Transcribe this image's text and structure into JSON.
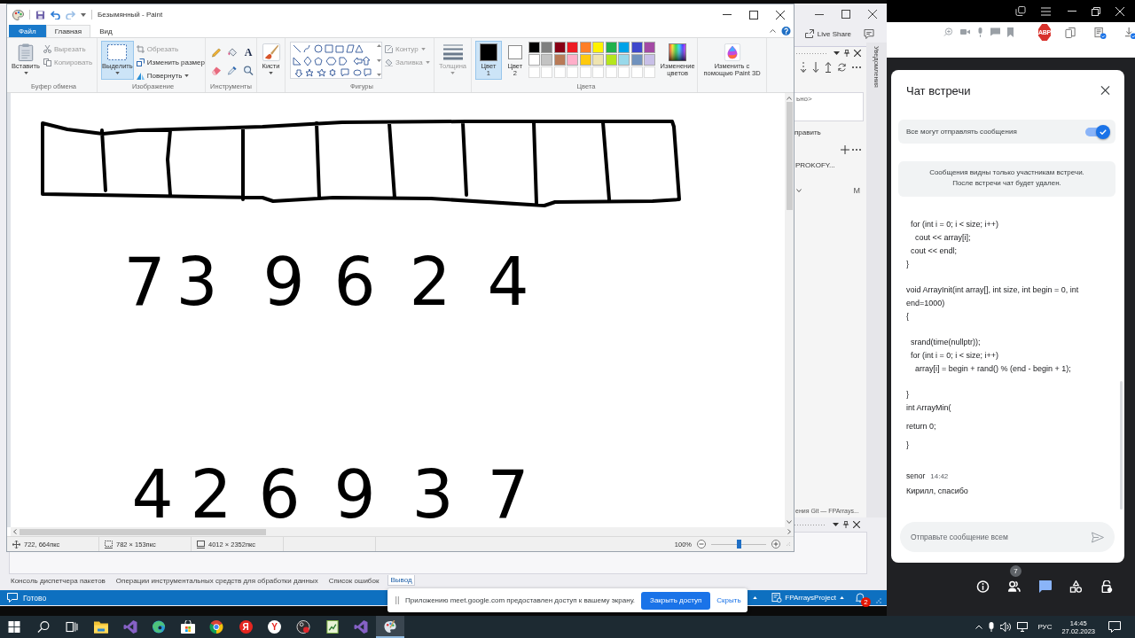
{
  "paint": {
    "title": "Безымянный - Paint",
    "tabs": [
      {
        "label": "Файл",
        "kind": "file",
        "selected": false
      },
      {
        "label": "Главная",
        "kind": "tab",
        "selected": true
      },
      {
        "label": "Вид",
        "kind": "tab",
        "selected": false
      }
    ],
    "clipboard": {
      "label": "Буфер обмена",
      "paste": "Вставить",
      "commands": [
        {
          "label": "Вырезать",
          "kind": "cut",
          "disabled": true,
          "dropdown": false
        },
        {
          "label": "Копировать",
          "kind": "copy",
          "disabled": true,
          "dropdown": false
        }
      ]
    },
    "image": {
      "label": "Изображение",
      "select": {
        "label": "Выделить",
        "selected": true
      },
      "commands": [
        {
          "label": "Обрезать",
          "kind": "crop",
          "disabled": true,
          "dropdown": false
        },
        {
          "label": "Изменить размер",
          "kind": "resize",
          "disabled": false,
          "dropdown": false
        },
        {
          "label": "Повернуть",
          "kind": "rotate",
          "disabled": false,
          "dropdown": true
        }
      ]
    },
    "tools": {
      "label": "Инструменты",
      "items": [
        {
          "kind": "pencil"
        },
        {
          "kind": "fill"
        },
        {
          "kind": "text",
          "glyph": "A"
        },
        {
          "kind": "eraser"
        },
        {
          "kind": "picker"
        },
        {
          "kind": "magnifier"
        }
      ]
    },
    "brushes": {
      "label": "Кисти"
    },
    "shapes": {
      "label": "Фигуры",
      "commands": [
        {
          "label": "Контур",
          "kind": "outline",
          "disabled": true,
          "dropdown": true
        },
        {
          "label": "Заливка",
          "kind": "fill",
          "disabled": true,
          "dropdown": true
        }
      ]
    },
    "size": {
      "label": "Толщина",
      "disabled": true
    },
    "colors": {
      "label": "Цвета",
      "color1": {
        "label": "Цвет 1",
        "color": "#000000",
        "selected": true
      },
      "color2": {
        "label": "Цвет 2",
        "color": "#ffffff",
        "selected": false
      },
      "palette": [
        {
          "color": "#000000"
        },
        {
          "color": "#7f7f7f"
        },
        {
          "color": "#880015"
        },
        {
          "color": "#ed1c24"
        },
        {
          "color": "#ff7f27"
        },
        {
          "color": "#fff200"
        },
        {
          "color": "#22b14c"
        },
        {
          "color": "#00a2e8"
        },
        {
          "color": "#3f48cc"
        },
        {
          "color": "#a349a4"
        },
        {
          "color": "#ffffff"
        },
        {
          "color": "#c3c3c3"
        },
        {
          "color": "#b97a57"
        },
        {
          "color": "#ffaec9"
        },
        {
          "color": "#ffc90e"
        },
        {
          "color": "#efe4b0"
        },
        {
          "color": "#b5e61d"
        },
        {
          "color": "#99d9ea"
        },
        {
          "color": "#7092be"
        },
        {
          "color": "#c8bfe7"
        }
      ],
      "edit": "Изменение цветов"
    },
    "paint3d": "Изменить с помощью Paint 3D",
    "canvas": {
      "digit_rows": [
        [
          "7",
          "3",
          "9",
          "6",
          "2",
          "4"
        ],
        [
          "4",
          "2",
          "6",
          "9",
          "3",
          "7"
        ]
      ]
    },
    "status_bar": {
      "cursor": "722, 664пкс",
      "selection": "782 × 153пкс",
      "image_size": "4012 × 2352пкс",
      "zoom": "100%",
      "zoom_slider": {
        "level": 0.5
      }
    }
  },
  "visual_studio": {
    "live_share": "Live Share",
    "notifications_tab": "Уведомления",
    "git_panel": {
      "message_field": "ьно>",
      "commit_button": "править",
      "branch": "PROKOFY...",
      "file_status": "M",
      "footer_tab": "ения Git — FPArrays..."
    },
    "output_tabs": [
      {
        "label": "Консоль диспетчера пакетов",
        "selected": false
      },
      {
        "label": "Операции инструментальных средств для обработки данных",
        "selected": false
      },
      {
        "label": "Список ошибок",
        "selected": false
      },
      {
        "label": "Вывод",
        "selected": true
      }
    ],
    "status_bar": {
      "text": "Готово",
      "project": "FPArraysProject",
      "notification_count": "2"
    }
  },
  "browser": {
    "adblock_badge": "ABP",
    "chat": {
      "title": "Чат встречи",
      "permission": {
        "label": "Все могут отправлять сообщения",
        "on": true
      },
      "notice": "Сообщения видны только участникам встречи. После встречи чат будет удален.",
      "code_blocks": [
        [
          "  for (int i = 0; i < size; i++)",
          "    cout << array[i];",
          "  cout << endl;",
          "}"
        ],
        [
          "void ArrayInit(int array[], int size, int begin = 0, int end=1000)",
          "{"
        ],
        [
          "  srand(time(nullptr));",
          "  for (int i = 0; i < size; i++)",
          "    array[i] = begin + rand() % (end - begin + 1);"
        ],
        [
          "}",
          "int ArrayMin("
        ],
        [
          "return 0;"
        ],
        [
          "}"
        ]
      ],
      "messages": [
        {
          "sender": "senor",
          "time": "14:42",
          "text": "Кирилл, спасибо"
        }
      ],
      "input": {
        "placeholder": "Отправьте сообщение всем"
      }
    },
    "controls": [
      {
        "kind": "info",
        "selected": false
      },
      {
        "kind": "people",
        "selected": false,
        "badge": "7"
      },
      {
        "kind": "chat",
        "selected": true
      },
      {
        "kind": "activities",
        "selected": false
      },
      {
        "kind": "host",
        "selected": false
      }
    ]
  },
  "screen_share_notice": {
    "text": "Приложению meet.google.com предоставлен доступ к вашему экрану.",
    "stop_button": "Закрыть доступ",
    "hide_link": "Скрыть"
  },
  "taskbar": {
    "items": [
      {
        "kind": "start",
        "selected": false
      },
      {
        "kind": "search",
        "selected": false
      },
      {
        "kind": "task_view",
        "selected": false
      },
      {
        "kind": "explorer",
        "selected": false
      },
      {
        "kind": "visual_studio",
        "selected": false
      },
      {
        "kind": "edge",
        "selected": false
      },
      {
        "kind": "store",
        "selected": false
      },
      {
        "kind": "chrome",
        "selected": false
      },
      {
        "kind": "yandex",
        "selected": false,
        "glyph": "Я"
      },
      {
        "kind": "yandex_browser",
        "selected": false,
        "glyph": "Y"
      },
      {
        "kind": "recorder",
        "selected": false
      },
      {
        "kind": "notes",
        "selected": false
      },
      {
        "kind": "visual_studio",
        "selected": false
      },
      {
        "kind": "paint",
        "selected": true
      }
    ],
    "language": "РУС",
    "time": "14:45",
    "date": "27.02.2023"
  }
}
